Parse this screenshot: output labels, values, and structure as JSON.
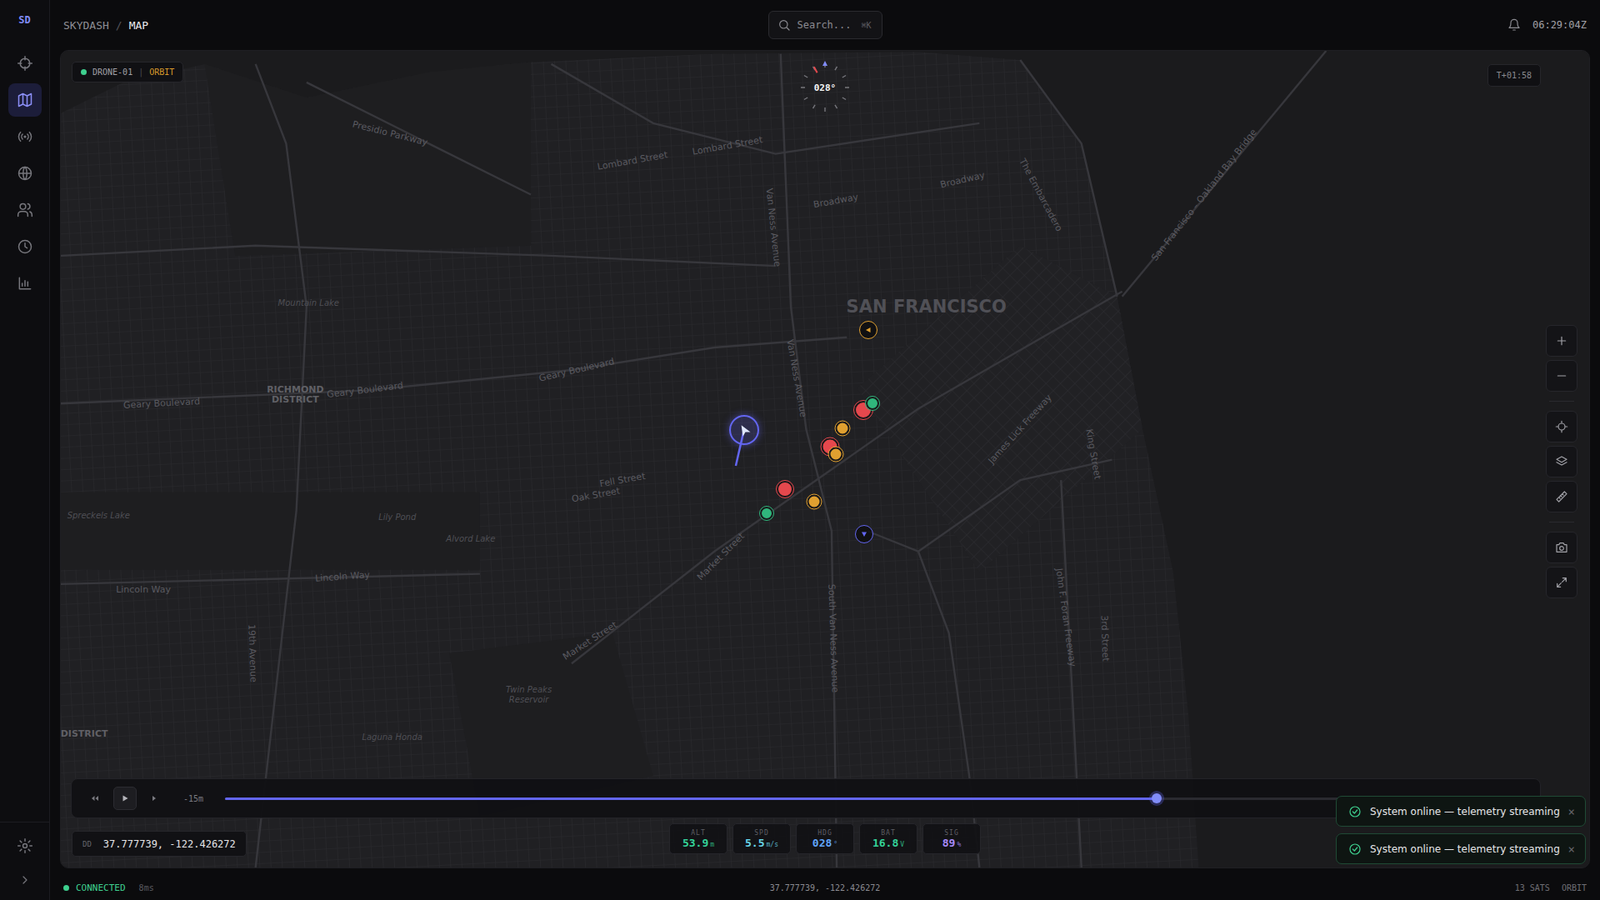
{
  "app": {
    "logo": "SD",
    "breadcrumb": [
      {
        "label": "SKYDASH",
        "selected": false
      },
      {
        "label": "MAP",
        "selected": true
      }
    ],
    "separator": "/"
  },
  "sidebar": {
    "items": [
      {
        "selected": false
      },
      {
        "selected": true
      },
      {
        "selected": false
      },
      {
        "selected": false
      },
      {
        "selected": false
      },
      {
        "selected": false
      },
      {
        "selected": false
      }
    ]
  },
  "search": {
    "placeholder": "Search...",
    "shortcut": "⌘K"
  },
  "clock": "06:29:04Z",
  "drone": {
    "name": "DRONE-01",
    "separator": "|",
    "mode": "ORBIT",
    "online": true
  },
  "mission_timer": "T+01:58",
  "compass": {
    "heading": "028°"
  },
  "map": {
    "labels": [
      "SAN FRANCISCO",
      "RICHMOND DISTRICT",
      "DISTRICT",
      "Presidio Parkway",
      "Lombard Street",
      "Lombard Street",
      "Broadway",
      "Broadway",
      "Geary Boulevard",
      "Geary Boulevard",
      "Geary Boulevard",
      "Fell Street",
      "Oak Street",
      "Market Street",
      "Market Street",
      "Lincoln Way",
      "Lincoln Way",
      "Van Ness Avenue",
      "Van Ness Avenue",
      "South Van Ness Avenue",
      "Mountain Lake",
      "Lily Pond",
      "Alvord Lake",
      "Spreckels Lake",
      "Twin Peaks Reservoir",
      "Laguna Honda",
      "The Embarcadero",
      "San Francisco – Oakland Bay Bridge",
      "James Lick Freeway",
      "John F. Foran Freeway",
      "King Street",
      "3rd Street",
      "19th Avenue"
    ],
    "markers": [
      {
        "kind": "drone",
        "color": "#6366f1"
      },
      {
        "kind": "arrow",
        "color": "#e0a030"
      },
      {
        "kind": "dot",
        "color": "#e5484d"
      },
      {
        "kind": "dot",
        "color": "#30b67c"
      },
      {
        "kind": "dot",
        "color": "#e0a030"
      },
      {
        "kind": "dot",
        "color": "#e5484d"
      },
      {
        "kind": "dot",
        "color": "#e0a030"
      },
      {
        "kind": "dot",
        "color": "#e5484d"
      },
      {
        "kind": "dot",
        "color": "#e0a030"
      },
      {
        "kind": "dot",
        "color": "#30b67c"
      },
      {
        "kind": "arrow",
        "color": "#6366f1"
      }
    ]
  },
  "timeline": {
    "offset": "-15m",
    "level": 0.715,
    "playing": false
  },
  "coordinates": {
    "format": "DD",
    "value": "37.777739, -122.426272"
  },
  "telemetry": [
    {
      "label": "ALT",
      "value": "53.9",
      "unit": "m",
      "color": "#34d399"
    },
    {
      "label": "SPD",
      "value": "5.5",
      "unit": "m/s",
      "color": "#67d4e8"
    },
    {
      "label": "HDG",
      "value": "028",
      "unit": "°",
      "color": "#60a5fa"
    },
    {
      "label": "BAT",
      "value": "16.8",
      "unit": "V",
      "color": "#34d399"
    },
    {
      "label": "SIG",
      "value": "89",
      "unit": "%",
      "color": "#a78bfa"
    }
  ],
  "toasts": [
    {
      "message": "System online — telemetry streaming",
      "dismiss": "×"
    },
    {
      "message": "System online — telemetry streaming",
      "dismiss": "×"
    }
  ],
  "status_bar": {
    "connection": "CONNECTED",
    "connected": true,
    "latency": "8ms",
    "coordinates": "37.777739, -122.426272",
    "satellites": "13 SATS",
    "mode": "ORBIT"
  }
}
